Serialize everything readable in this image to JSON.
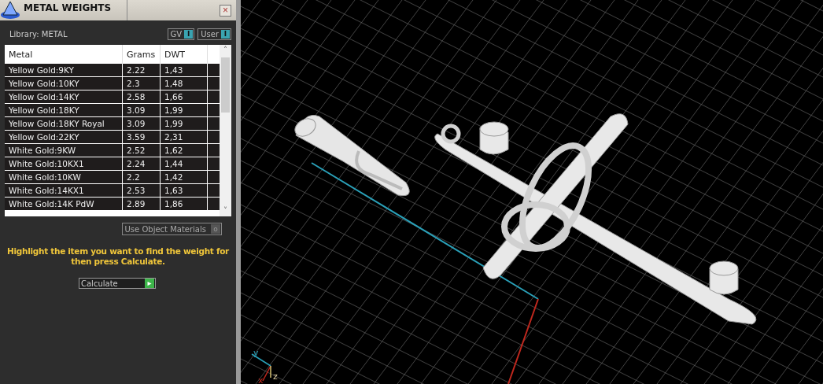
{
  "panel": {
    "title": "METAL WEIGHTS",
    "close_glyph": "×",
    "library_label": "Library: METAL",
    "toggles": [
      {
        "label": "GV",
        "glyph": "I",
        "on": true
      },
      {
        "label": "User",
        "glyph": "I",
        "on": true
      }
    ],
    "table": {
      "columns": [
        "Metal",
        "Grams",
        "DWT"
      ],
      "rows": [
        {
          "cells": [
            "Yellow Gold:9KY",
            "2.22",
            "1,43"
          ]
        },
        {
          "cells": [
            "Yellow Gold:10KY",
            "2.3",
            "1,48"
          ]
        },
        {
          "cells": [
            "Yellow Gold:14KY",
            "2.58",
            "1,66"
          ]
        },
        {
          "cells": [
            "Yellow Gold:18KY",
            "3.09",
            "1,99"
          ]
        },
        {
          "cells": [
            "Yellow Gold:18KY Royal",
            "3.09",
            "1,99"
          ]
        },
        {
          "cells": [
            "Yellow Gold:22KY",
            "3.59",
            "2,31"
          ]
        },
        {
          "cells": [
            "White Gold:9KW",
            "2.52",
            "1,62"
          ]
        },
        {
          "cells": [
            "White Gold:10KX1",
            "2.24",
            "1,44"
          ]
        },
        {
          "cells": [
            "White Gold:10KW",
            "2.2",
            "1,42"
          ]
        },
        {
          "cells": [
            "White Gold:14KX1",
            "2.53",
            "1,63"
          ]
        },
        {
          "cells": [
            "White Gold:14K PdW",
            "2.89",
            "1,86"
          ]
        }
      ],
      "scroll_up": "˄",
      "scroll_down": "˅"
    },
    "use_object_materials": {
      "label": "Use Object Materials",
      "glyph": "o",
      "checked": false
    },
    "hint": "Highlight the item you want to find the weight for then press Calculate.",
    "calculate": {
      "label": "Calculate",
      "glyph": "▸"
    }
  },
  "viewport": {
    "axes": [
      "y",
      "x",
      "z"
    ]
  }
}
